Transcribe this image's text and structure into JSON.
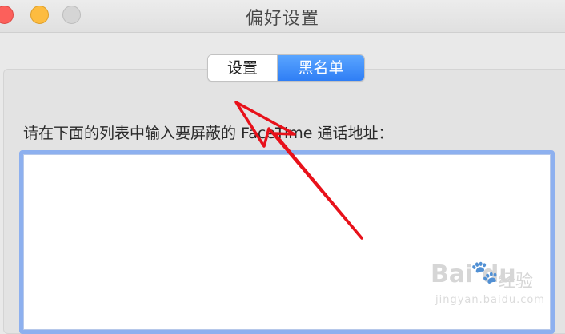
{
  "window": {
    "title": "偏好设置"
  },
  "tabs": [
    {
      "label": "设置",
      "selected": false
    },
    {
      "label": "黑名单",
      "selected": true
    }
  ],
  "instruction": "请在下面的列表中输入要屏蔽的 FaceTime 通话地址：",
  "blocked_list": {
    "items": []
  },
  "watermark": {
    "brand": "Bai",
    "brand_suffix": "du",
    "product": "经验",
    "url": "jingyan.baidu.com"
  },
  "colors": {
    "accent": "#2f7ef5",
    "annotation_arrow": "#e8111a",
    "close": "#fc605b",
    "minimize": "#fdbc40",
    "zoom_inactive": "#d5d5d5"
  }
}
